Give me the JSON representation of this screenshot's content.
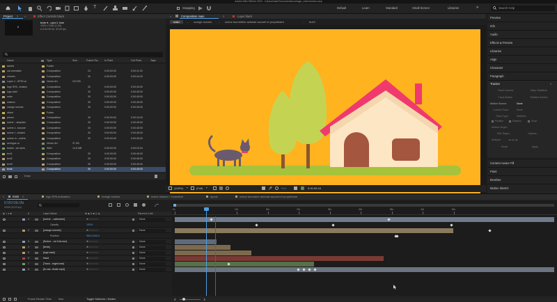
{
  "app_title": "Adobe After Effects 2022 - /Users/main/Documents/montage_video/motion.aep",
  "workspaces": [
    "Default",
    "Learn",
    "Standard",
    "Small Screen",
    "Libraries"
  ],
  "snapping_label": "Snapping",
  "help_search_placeholder": "Search Help",
  "project": {
    "tab": "Project",
    "effect_controls_tab": "Effect Controls black",
    "selected_name": "texte ▾ , used 1 time",
    "selected_size": "1920 x 1080 (1,00)",
    "selected_duration": "Δ 0:00:30:00, 30,00 fps",
    "search_placeholder": "⌕",
    "columns": [
      "Name",
      "Type",
      "Size",
      "Frame Ra...",
      "In Point",
      "Out Point",
      "Tape"
    ],
    "rows": [
      {
        "name": "assets",
        "type": "Folder",
        "size": "",
        "fps": "",
        "in": "",
        "out": "",
        "color": "#c9b24a"
      },
      {
        "name": "cat animation",
        "type": "Composition",
        "size": "",
        "fps": "24",
        "in": "0:00:00:00",
        "out": "0:00:11:03",
        "color": "#b3a07a"
      },
      {
        "name": "chemin",
        "type": "Composition",
        "size": "",
        "fps": "30",
        "in": "0:00:00:00",
        "out": "0:00:44:20",
        "color": "#b3a07a"
      },
      {
        "name": "Layer 1...SP92.ai",
        "type": "Vector Art",
        "size": "213 KB",
        "fps": "",
        "in": "",
        "out": "",
        "color": "#888888"
      },
      {
        "name": "logo SPA...imation",
        "type": "Composition",
        "size": "",
        "fps": "30",
        "in": "0:00:00:00",
        "out": "0:00:45:00",
        "color": "#b3a07a"
      },
      {
        "name": "logo start",
        "type": "Composition",
        "size": "",
        "fps": "30",
        "in": "0:00:00:00",
        "out": "0:00:45:00",
        "color": "#b3a07a"
      },
      {
        "name": "main",
        "type": "Composition",
        "size": "",
        "fps": "30",
        "in": "0:00:00:00",
        "out": "0:00:45:00",
        "color": "#b3a07a"
      },
      {
        "name": "maison",
        "type": "Composition",
        "size": "",
        "fps": "30",
        "in": "0:00:00:00",
        "out": "0:00:45:00",
        "color": "#b3a07a"
      },
      {
        "name": "orange scenes",
        "type": "Composition",
        "size": "",
        "fps": "30",
        "in": "0:00:00:00",
        "out": "0:00:45:00",
        "color": "#b3a07a"
      },
      {
        "name": "othert",
        "type": "Folder",
        "size": "",
        "fps": "",
        "in": "",
        "out": "",
        "color": "#c9b24a"
      },
      {
        "name": "prison",
        "type": "Composition",
        "size": "",
        "fps": "30",
        "in": "0:00:00:00",
        "out": "0:00:10:00",
        "color": "#b3a07a"
      },
      {
        "name": "scène ...sbeplain",
        "type": "Composition",
        "size": "",
        "fps": "30",
        "in": "0:00:00:00",
        "out": "0:00:45:00",
        "color": "#b3a07a"
      },
      {
        "name": "scène v...hacune",
        "type": "Composition",
        "size": "",
        "fps": "30",
        "in": "0:00:00:00",
        "out": "0:00:45:00",
        "color": "#b3a07a"
      },
      {
        "name": "scène f...rstcaire",
        "type": "Composition",
        "size": "",
        "fps": "30",
        "in": "0:00:00:00",
        "out": "0:00:45:00",
        "color": "#b3a07a"
      },
      {
        "name": "scène m...urrière",
        "type": "Composition",
        "size": "",
        "fps": "30",
        "in": "0:00:00:00",
        "out": "0:00:45:00",
        "color": "#b3a07a"
      },
      {
        "name": "seringue ai",
        "type": "Vector Art",
        "size": "37 KB",
        "fps": "",
        "in": "",
        "out": "",
        "color": "#888888"
      },
      {
        "name": "testee...ser.sees",
        "type": "WAV",
        "size": "14,5 MB",
        "fps": "",
        "in": "0:00:00:00",
        "out": "0:00:20:04",
        "color": "#6f9c5a"
      },
      {
        "name": "text1",
        "type": "Composition",
        "size": "",
        "fps": "30",
        "in": "0:00:00:00",
        "out": "0:00:45:00",
        "color": "#b3a07a"
      },
      {
        "name": "text2",
        "type": "Composition",
        "size": "",
        "fps": "30",
        "in": "0:00:00:00",
        "out": "0:00:45:00",
        "color": "#b3a07a"
      },
      {
        "name": "text3",
        "type": "Composition",
        "size": "",
        "fps": "30",
        "in": "0:00:00:00",
        "out": "0:00:45:00",
        "color": "#b3a07a"
      },
      {
        "name": "texte",
        "type": "Composition",
        "size": "",
        "fps": "30",
        "in": "0:00:00:00",
        "out": "0:00:45:00",
        "color": "#b3a07a",
        "selected": true
      }
    ],
    "footer_bpc": "8 bpc"
  },
  "composition": {
    "panel_tab": "Composition main",
    "layer_tab": "Layer black",
    "subtabs": [
      "main",
      "orange scenes",
      "scène fourmilière animale accueil et propriétaire",
      "text3"
    ],
    "zoom": "(100%)",
    "resolution": "(Full)",
    "exposure": "+0,0",
    "timecode": "0:00:05:18"
  },
  "right_panels": {
    "items": [
      "Preview",
      "Info",
      "Audio",
      "Effects & Presets",
      "Libraries",
      "Align",
      "Character",
      "Paragraph"
    ],
    "tracker": {
      "title": "Tracker",
      "buttons": [
        "Track Camera",
        "Warp Stabilizer",
        "Track Motion",
        "Stabilize Motion"
      ],
      "motion_source_label": "Motion Source:",
      "motion_source_value": "None",
      "current_track_label": "Current Track:",
      "current_track_value": "None",
      "track_type_label": "Track Type:",
      "track_type_value": "Stabilize",
      "checks": [
        "Position",
        "Rotation",
        "Scale"
      ],
      "motion_target": "Motion Target:",
      "edit_target": "Edit Target...",
      "options": "Options...",
      "analyze": "Analyze:",
      "reset": "Reset",
      "apply": "Apply"
    },
    "bottom_items": [
      "Content-Aware Fill",
      "Paint",
      "Brushes",
      "Motion Sketch"
    ]
  },
  "timeline": {
    "tabs": [
      "main",
      "logo SPA animation",
      "orange scenes",
      "scène maison + fourmière",
      "spook",
      "scène fourmière animale accueil et propriétaire"
    ],
    "timecode": "0:00:05:05",
    "timecode_sub": "00155 (30,00 fps)",
    "columns": {
      "num": "#",
      "layer_name": "Layer Name",
      "parent": "Parent & Link"
    },
    "ruler": [
      "0s",
      "05s",
      "10s",
      "15s",
      "20s",
      "25s",
      "30s",
      "35s",
      "40s",
      "45s"
    ],
    "layers": [
      {
        "num": "1",
        "name": "[scène ...uctimanie]",
        "parent": "None",
        "color": "#8a9bb0"
      },
      {
        "num": "",
        "name": "Opacity",
        "parent": "",
        "value": "100%",
        "prop": true
      },
      {
        "num": "2",
        "name": "[orange scenes]",
        "parent": "None",
        "color": "#b89a6a"
      },
      {
        "num": "",
        "name": "Position",
        "parent": "",
        "value": "960,0,540,0",
        "prop": true
      },
      {
        "num": "3",
        "name": "[Scène ...ne Kat.mov]",
        "parent": "None",
        "color": "#8a9bb0"
      },
      {
        "num": "4",
        "name": "[texts]",
        "parent": "None",
        "color": "#b89a6a"
      },
      {
        "num": "5",
        "name": "[logo start]",
        "parent": "None",
        "color": "#b89a6a"
      },
      {
        "num": "6",
        "name": "black",
        "parent": "None",
        "color": "#a0463f"
      },
      {
        "num": "7",
        "name": "[Track...erged.wav]",
        "parent": "None",
        "color": "#6f9c5a"
      },
      {
        "num": "8",
        "name": "[le-cav...finale.mp4]",
        "parent": "None",
        "color": "#8a9bb0"
      }
    ],
    "footer_left": "Frame Render Time",
    "footer_time": "0ms",
    "footer_toggle": "Toggle Switches / Modes"
  },
  "colors": {
    "accent": "#4d9fe6",
    "comp_bg": "#ffb31f",
    "selected_row": "#3a4b66"
  }
}
